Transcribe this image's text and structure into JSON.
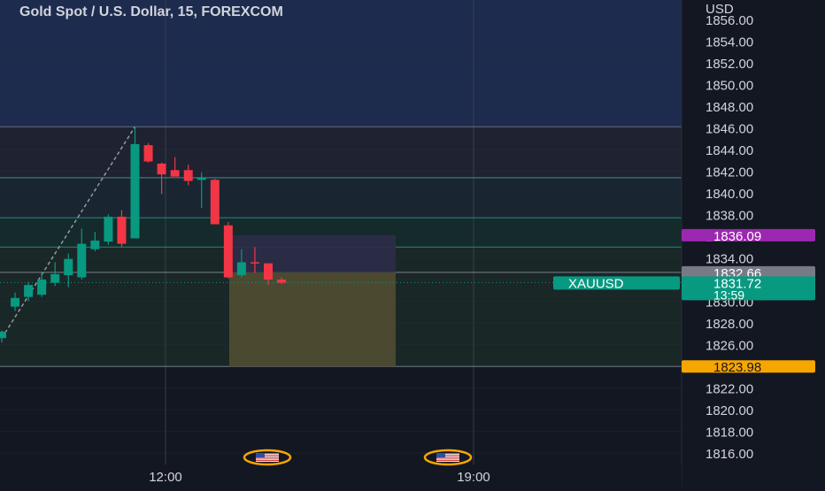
{
  "header": {
    "title": "Gold Spot / U.S. Dollar, 15, FOREXCOM"
  },
  "price_axis": {
    "currency": "USD",
    "ticks": [
      "1856.00",
      "1854.00",
      "1852.00",
      "1850.00",
      "1848.00",
      "1846.00",
      "1844.00",
      "1842.00",
      "1840.00",
      "1838.00",
      "1836.00",
      "1834.00",
      "1832.00",
      "1830.00",
      "1828.00",
      "1826.00",
      "1824.00",
      "1822.00",
      "1820.00",
      "1818.00",
      "1816.00"
    ]
  },
  "time_axis": {
    "ticks": [
      "12:00",
      "19:00"
    ]
  },
  "price_labels": {
    "resistance": "1836.09",
    "prev_close": "1832.66",
    "symbol": "XAUUSD",
    "last_price": "1831.72",
    "countdown": "13:59",
    "target": "1823.98"
  },
  "colors": {
    "background": "#131722",
    "zone_top": "#1d2b4e",
    "up_candle": "#089981",
    "down_candle": "#f23645",
    "resistance_label": "#9c27b0",
    "prev_close_label": "#787b86",
    "last_price_label": "#089981",
    "target_label": "#f7a600",
    "short_profit_zone": "#4f4b31",
    "short_risk_zone": "#2c2c48"
  },
  "icons": [
    "us-flag-event-icon",
    "us-flag-event-icon"
  ],
  "chart_data": {
    "type": "candlestick",
    "title": "Gold Spot / U.S. Dollar, 15, FOREXCOM",
    "ylabel": "USD",
    "ylim": [
      1815.0,
      1857.2
    ],
    "grid": true,
    "x_ticks": [
      "12:00",
      "19:00"
    ],
    "candles": [
      {
        "o": 1826.6,
        "h": 1827.3,
        "l": 1826.2,
        "c": 1827.2
      },
      {
        "o": 1829.5,
        "h": 1830.8,
        "l": 1829.1,
        "c": 1830.3
      },
      {
        "o": 1830.4,
        "h": 1831.8,
        "l": 1830.0,
        "c": 1831.5
      },
      {
        "o": 1830.6,
        "h": 1832.6,
        "l": 1830.4,
        "c": 1832.0
      },
      {
        "o": 1831.7,
        "h": 1833.6,
        "l": 1831.4,
        "c": 1832.5
      },
      {
        "o": 1832.4,
        "h": 1834.4,
        "l": 1831.3,
        "c": 1833.9
      },
      {
        "o": 1832.2,
        "h": 1836.7,
        "l": 1832.0,
        "c": 1835.3
      },
      {
        "o": 1834.8,
        "h": 1836.4,
        "l": 1834.6,
        "c": 1835.6
      },
      {
        "o": 1835.5,
        "h": 1838.0,
        "l": 1835.2,
        "c": 1837.8
      },
      {
        "o": 1837.8,
        "h": 1838.4,
        "l": 1835.0,
        "c": 1835.3
      },
      {
        "o": 1835.8,
        "h": 1846.1,
        "l": 1835.8,
        "c": 1844.5
      },
      {
        "o": 1844.4,
        "h": 1844.6,
        "l": 1842.8,
        "c": 1842.9
      },
      {
        "o": 1842.7,
        "h": 1842.8,
        "l": 1839.9,
        "c": 1841.7
      },
      {
        "o": 1842.1,
        "h": 1843.3,
        "l": 1841.9,
        "c": 1841.5
      },
      {
        "o": 1842.1,
        "h": 1842.6,
        "l": 1840.7,
        "c": 1841.1
      },
      {
        "o": 1841.2,
        "h": 1841.9,
        "l": 1838.6,
        "c": 1841.4
      },
      {
        "o": 1841.2,
        "h": 1841.3,
        "l": 1837.3,
        "c": 1837.1
      },
      {
        "o": 1837.0,
        "h": 1837.3,
        "l": 1832.1,
        "c": 1832.2
      },
      {
        "o": 1832.4,
        "h": 1834.8,
        "l": 1832.2,
        "c": 1833.6
      },
      {
        "o": 1833.6,
        "h": 1835.0,
        "l": 1832.6,
        "c": 1833.5
      },
      {
        "o": 1833.5,
        "h": 1833.5,
        "l": 1831.5,
        "c": 1832.0
      },
      {
        "o": 1832.0,
        "h": 1832.2,
        "l": 1831.6,
        "c": 1831.7
      }
    ],
    "horizontal_levels": [
      1846.1,
      1841.4,
      1837.7,
      1835.0,
      1832.66,
      1823.98
    ],
    "position_tool": {
      "type": "short",
      "entry": 1832.66,
      "stop": 1836.09,
      "target": 1823.98
    },
    "event_markers": [
      "12:00",
      "19:00"
    ]
  }
}
